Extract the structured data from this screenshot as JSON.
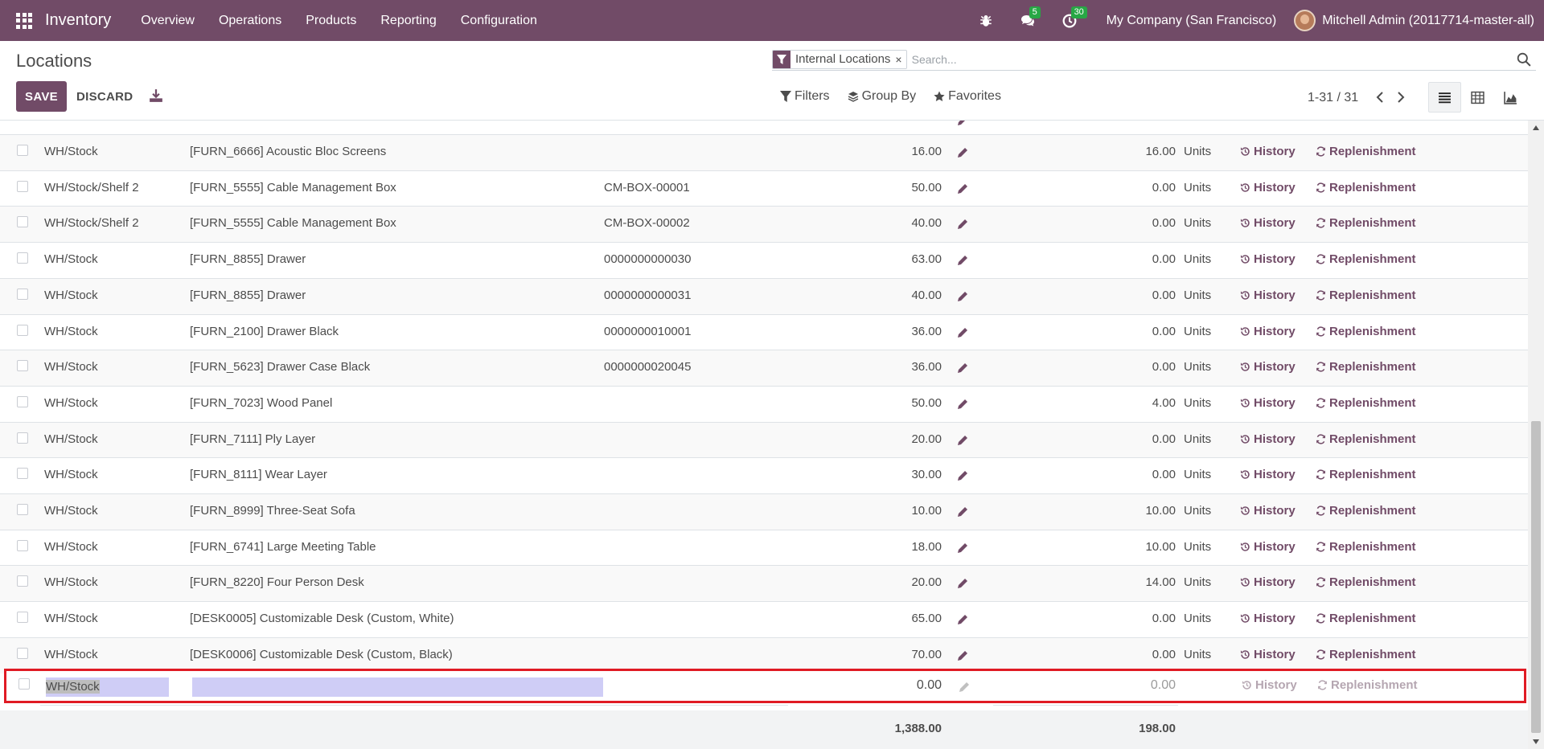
{
  "navbar": {
    "brand": "Inventory",
    "menu": [
      "Overview",
      "Operations",
      "Products",
      "Reporting",
      "Configuration"
    ],
    "messages_badge": "5",
    "activities_badge": "30",
    "company": "My Company (San Francisco)",
    "user": "Mitchell Admin (20117714-master-all)"
  },
  "control_panel": {
    "title": "Locations",
    "save_label": "SAVE",
    "discard_label": "DISCARD",
    "search": {
      "facet_value": "Internal Locations",
      "facet_remove": "×",
      "placeholder": "Search..."
    },
    "filters_label": "Filters",
    "group_by_label": "Group By",
    "favorites_label": "Favorites",
    "pager": "1-31 / 31"
  },
  "list": {
    "uom": "Units",
    "history_label": "History",
    "replenishment_label": "Replenishment",
    "rows": [
      {
        "location": "WH/Stock",
        "product": "[FURN_6666] Acoustic Bloc Screens",
        "lot": "",
        "qty": "16.00",
        "reserved": "16.00"
      },
      {
        "location": "WH/Stock/Shelf 2",
        "product": "[FURN_5555] Cable Management Box",
        "lot": "CM-BOX-00001",
        "qty": "50.00",
        "reserved": "0.00"
      },
      {
        "location": "WH/Stock/Shelf 2",
        "product": "[FURN_5555] Cable Management Box",
        "lot": "CM-BOX-00002",
        "qty": "40.00",
        "reserved": "0.00"
      },
      {
        "location": "WH/Stock",
        "product": "[FURN_8855] Drawer",
        "lot": "0000000000030",
        "qty": "63.00",
        "reserved": "0.00"
      },
      {
        "location": "WH/Stock",
        "product": "[FURN_8855] Drawer",
        "lot": "0000000000031",
        "qty": "40.00",
        "reserved": "0.00"
      },
      {
        "location": "WH/Stock",
        "product": "[FURN_2100] Drawer Black",
        "lot": "0000000010001",
        "qty": "36.00",
        "reserved": "0.00"
      },
      {
        "location": "WH/Stock",
        "product": "[FURN_5623] Drawer Case Black",
        "lot": "0000000020045",
        "qty": "36.00",
        "reserved": "0.00"
      },
      {
        "location": "WH/Stock",
        "product": "[FURN_7023] Wood Panel",
        "lot": "",
        "qty": "50.00",
        "reserved": "4.00"
      },
      {
        "location": "WH/Stock",
        "product": "[FURN_7111] Ply Layer",
        "lot": "",
        "qty": "20.00",
        "reserved": "0.00"
      },
      {
        "location": "WH/Stock",
        "product": "[FURN_8111] Wear Layer",
        "lot": "",
        "qty": "30.00",
        "reserved": "0.00"
      },
      {
        "location": "WH/Stock",
        "product": "[FURN_8999] Three-Seat Sofa",
        "lot": "",
        "qty": "10.00",
        "reserved": "10.00"
      },
      {
        "location": "WH/Stock",
        "product": "[FURN_6741] Large Meeting Table",
        "lot": "",
        "qty": "18.00",
        "reserved": "10.00"
      },
      {
        "location": "WH/Stock",
        "product": "[FURN_8220] Four Person Desk",
        "lot": "",
        "qty": "20.00",
        "reserved": "14.00"
      },
      {
        "location": "WH/Stock",
        "product": "[DESK0005] Customizable Desk (Custom, White)",
        "lot": "",
        "qty": "65.00",
        "reserved": "0.00"
      },
      {
        "location": "WH/Stock",
        "product": "[DESK0006] Customizable Desk (Custom, Black)",
        "lot": "",
        "qty": "70.00",
        "reserved": "0.00"
      }
    ],
    "new_row": {
      "location": "WH/Stock",
      "qty": "0.00",
      "reserved": "0.00"
    },
    "totals": {
      "qty": "1,388.00",
      "reserved": "198.00"
    }
  },
  "colors": {
    "brand": "#714b67",
    "badge": "#28a745",
    "highlight": "#e01b24"
  }
}
